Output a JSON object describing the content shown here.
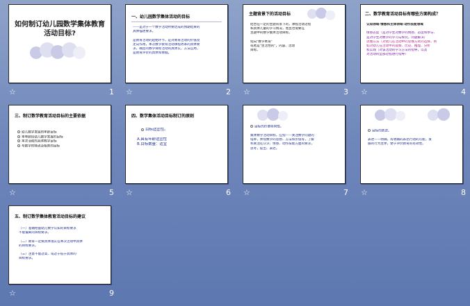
{
  "slides": [
    {
      "number": "1",
      "title": "如何制订幼儿园数学集体教育活动目标?"
    },
    {
      "number": "2",
      "title": "一、幼儿园数学集体活动的目标",
      "lines": [
        "——是对于一个数学活动所要达成的预期结果的",
        "具体描述要求。",
        "",
        "是教育活动的起始环节，是对教育活动的价值及",
        "走向作用，本次数学教育活动课程改革的具体要",
        "求，确定的数学目标活动的具体实，方法应用，",
        "是教育评价的具体和依据。"
      ]
    },
    {
      "number": "3",
      "title": "主题背景下的活动目标",
      "lines": [
        "结合在一定的主题背景下的，课程活动过程",
        "和具体儿童的学习情况，而且也需要在",
        "主题中的数学集体活动目标。",
        "",
        "指向\"数学本身\"",
        "或者是\"生活性的\"，内容、活动",
        "目标。"
      ]
    },
    {
      "number": "4",
      "title": "二、数学教育活动目标有哪些方面构成？",
      "lines": [
        "认知领域-情感和主体领域-动作技能领域",
        "",
        "情感态度（是对学生对数学的情感、态度和参与、",
        "是对学生对数学的学习与探究，问题解决）",
        "思维方法（对幼儿在活动中的思维方式的选择，例",
        "如对幼儿在活动中的观察、比较、推理、分析",
        "和实践（对该活动的学习方法的指导，以及",
        "对活动的全部过程进行指导）"
      ]
    },
    {
      "number": "5",
      "title": "三、制订数学教育活动目标的主要依据",
      "lines": [
        "幼儿数学发展的年龄目标",
        "本年龄段幼儿数学发展的目标",
        "本次活动的具体教学目标",
        "与数学的特点及相关的目标"
      ]
    },
    {
      "number": "6",
      "title": "四、数学集体活动目标制订的原则",
      "lines": [
        "目标适宜性。",
        "",
        "A.具有年龄适宜性",
        "B.目标数量：适宜"
      ]
    },
    {
      "number": "7",
      "title": "",
      "lines": [
        "目标的价值导向性。",
        "",
        "集体数学活动目标，应指——关注数学问题的",
        "培养，体现数学的思想、方法和价值等，了解",
        "和关注在认识、情感、动作技能方面的要求，",
        "思考，提出、表达。"
      ]
    },
    {
      "number": "8",
      "title": "",
      "lines": [
        "目标的表述。",
        "",
        "表述——明确，有明确的表达行动的可能，发",
        "展的行为主体，便于评价教育的有效性。"
      ]
    },
    {
      "number": "9",
      "title": "五、制订数学集体教育活动目标的建议",
      "lines": [
        "（一）准确把握幼儿数学认知的目标要求",
        "不能偏离的目标要求。",
        "",
        "（二）教育一定要具体落实在本次活动中具体",
        "的目标要求。",
        "",
        "（三）注意不能过高、或过于低于具体的",
        "目标要求。"
      ]
    }
  ]
}
